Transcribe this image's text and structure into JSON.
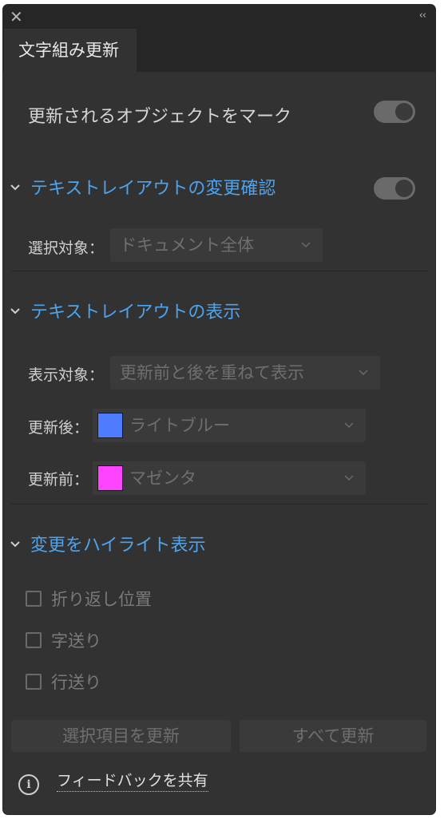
{
  "panel": {
    "collapse_glyph": "‹‹",
    "tab_label": "文字組み更新"
  },
  "mark_objects": {
    "label": "更新されるオブジェクトをマーク",
    "toggle_on": true
  },
  "check_section": {
    "title": "テキストレイアウトの変更確認",
    "toggle_on": true,
    "target_label": "選択対象：",
    "target_value": "ドキュメント全体"
  },
  "display_section": {
    "title": "テキストレイアウトの表示",
    "display_label": "表示対象：",
    "display_value": "更新前と後を重ねて表示",
    "after_label": "更新後：",
    "after_value": "ライトブルー",
    "after_color": "#4f7bff",
    "before_label": "更新前：",
    "before_value": "マゼンタ",
    "before_color": "#ff44ff"
  },
  "highlight_section": {
    "title": "変更をハイライト表示",
    "options": [
      {
        "label": "折り返し位置",
        "checked": false
      },
      {
        "label": "字送り",
        "checked": false
      },
      {
        "label": "行送り",
        "checked": false
      }
    ]
  },
  "buttons": {
    "update_selected": "選択項目を更新",
    "update_all": "すべて更新"
  },
  "feedback": {
    "info": "i",
    "label": "フィードバックを共有"
  },
  "colors": {
    "accent": "#4ea3ee",
    "panel_bg": "#323232"
  }
}
